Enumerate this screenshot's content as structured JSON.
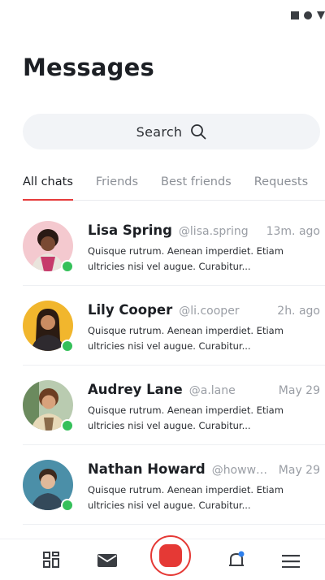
{
  "colors": {
    "accent": "#e63b3b",
    "online": "#35c05a",
    "text": "#1c1f24",
    "muted": "#8b8f96"
  },
  "page": {
    "title": "Messages"
  },
  "search": {
    "label": "Search",
    "icon": "search-icon"
  },
  "tabs": [
    {
      "label": "All chats",
      "active": true
    },
    {
      "label": "Friends",
      "active": false
    },
    {
      "label": "Best friends",
      "active": false
    },
    {
      "label": "Requests",
      "active": false
    }
  ],
  "chats": [
    {
      "name": "Lisa Spring",
      "handle": "@lisa.spring",
      "time": "13m. ago",
      "preview": "Quisque rutrum. Aenean imperdiet. Etiam ultricies nisi vel augue. Curabitur...",
      "online": true
    },
    {
      "name": "Lily Cooper",
      "handle": "@li.cooper",
      "time": "2h. ago",
      "preview": "Quisque rutrum. Aenean imperdiet. Etiam ultricies nisi vel augue. Curabitur...",
      "online": true
    },
    {
      "name": "Audrey Lane",
      "handle": "@a.lane",
      "time": "May 29",
      "preview": "Quisque rutrum. Aenean imperdiet. Etiam ultricies nisi vel augue. Curabitur...",
      "online": true
    },
    {
      "name": "Nathan Howard",
      "handle": "@howwa...",
      "time": "May 29",
      "preview": "Quisque rutrum. Aenean imperdiet. Etiam ultricies nisi vel augue. Curabitur...",
      "online": true
    }
  ],
  "bottom_nav": {
    "items": [
      "grid-icon",
      "mail-icon",
      "record-icon",
      "bell-icon",
      "menu-icon"
    ]
  }
}
